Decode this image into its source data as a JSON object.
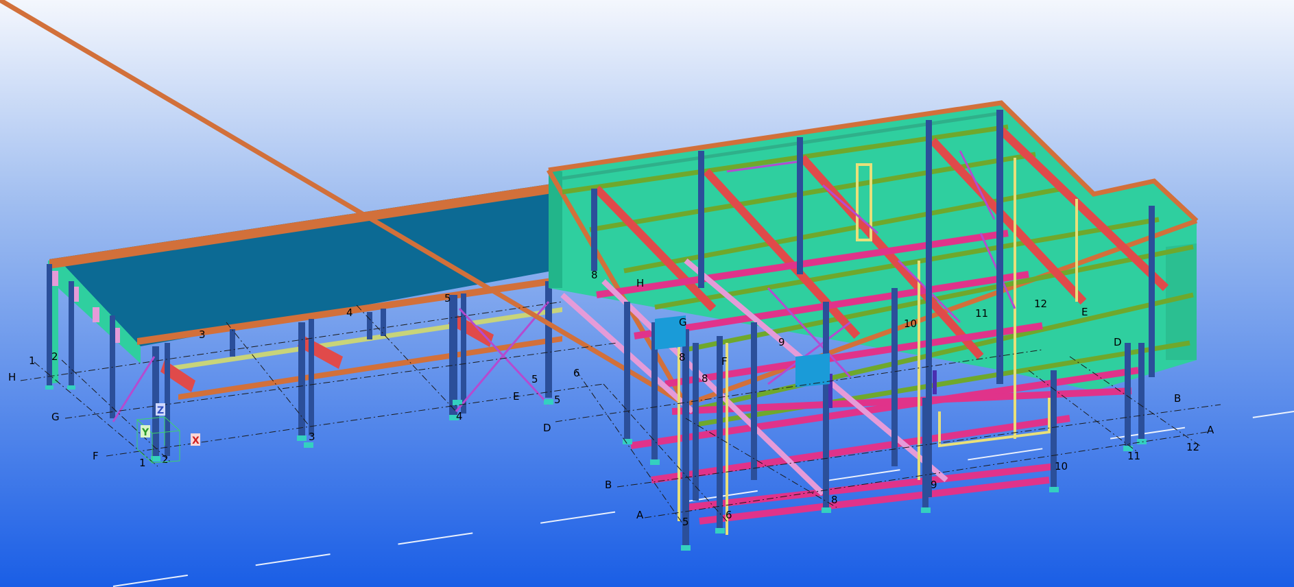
{
  "viewport": {
    "background_top": "#f4f7fd",
    "background_bottom": "#1a5ee6"
  },
  "colors": {
    "column": "#2b4f9a",
    "column_dark": "#1e3b80",
    "beam_orange": "#d2703a",
    "beam_pink": "#e0338a",
    "beam_green": "#6fa82c",
    "beam_red": "#e04a4a",
    "beam_yellow": "#e8e07a",
    "brace_purple": "#b44bd0",
    "wall_teal": "#2fcf9f",
    "roof_blue": "#0c6a94",
    "baseplate": "#34d0c0",
    "grid_line": "#1a1a1a"
  },
  "grid_labels": {
    "west_block": {
      "h": "H",
      "g": "G",
      "f": "F",
      "n1": "1",
      "n2": "2",
      "n3": "3",
      "n4": "4",
      "n5": "5",
      "n1b": "1",
      "n2b": "2",
      "n3b": "3",
      "n4b": "4"
    },
    "east_block": {
      "d": "D",
      "e": "E",
      "f": "F",
      "b": "B",
      "a": "A",
      "h": "H",
      "g": "G",
      "n5": "5",
      "n5b": "5",
      "n6": "6",
      "n6b": "6",
      "n8": "8",
      "n8b": "8",
      "n8c": "8",
      "n8d": "8",
      "n9": "9",
      "n9b": "9",
      "n10": "10",
      "n10b": "10",
      "n11": "11",
      "n11b": "11",
      "n12": "12",
      "n12b": "12",
      "e2": "E",
      "d2": "D",
      "b2": "B",
      "a2": "A"
    }
  },
  "axes": {
    "x": "X",
    "y": "Y",
    "z": "Z"
  }
}
